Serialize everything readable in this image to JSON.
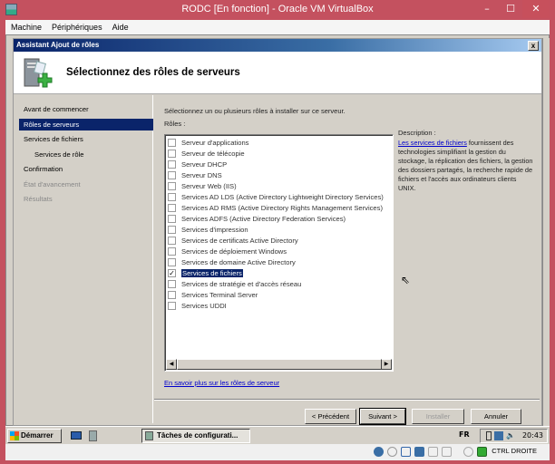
{
  "window": {
    "title": "RODC [En fonction] - Oracle VM VirtualBox",
    "minimize": "–",
    "maximize": "☐",
    "close": "✕"
  },
  "menu": [
    "Machine",
    "Périphériques",
    "Aide"
  ],
  "dialog": {
    "title": "Assistant Ajout de rôles",
    "close": "x",
    "header": "Sélectionnez des rôles de serveurs"
  },
  "nav": [
    {
      "label": "Avant de commencer",
      "state": "normal"
    },
    {
      "label": "Rôles de serveurs",
      "state": "selected"
    },
    {
      "label": "Services de fichiers",
      "state": "normal"
    },
    {
      "label": "Services de rôle",
      "state": "sub"
    },
    {
      "label": "Confirmation",
      "state": "normal"
    },
    {
      "label": "État d'avancement",
      "state": "disabled"
    },
    {
      "label": "Résultats",
      "state": "disabled"
    }
  ],
  "main": {
    "instruction": "Sélectionnez un ou plusieurs rôles à installer sur ce serveur.",
    "roles_label": "Rôles :",
    "description_label": "Description :",
    "description_link": "Les services de fichiers",
    "description_text": " fournissent des technologies simplifiant la gestion du stockage, la réplication des fichiers, la gestion des dossiers partagés, la recherche rapide de fichiers et l'accès aux ordinateurs clients UNIX.",
    "learn_more": "En savoir plus sur les rôles de serveur",
    "roles": [
      {
        "label": "Serveur d'applications",
        "checked": false
      },
      {
        "label": "Serveur de télécopie",
        "checked": false
      },
      {
        "label": "Serveur DHCP",
        "checked": false
      },
      {
        "label": "Serveur DNS",
        "checked": false
      },
      {
        "label": "Serveur Web (IIS)",
        "checked": false
      },
      {
        "label": "Services AD LDS (Active Directory Lightweight Directory Services)",
        "checked": false
      },
      {
        "label": "Services AD RMS (Active Directory Rights Management Services)",
        "checked": false
      },
      {
        "label": "Services ADFS (Active Directory Federation Services)",
        "checked": false
      },
      {
        "label": "Services d'impression",
        "checked": false
      },
      {
        "label": "Services de certificats Active Directory",
        "checked": false
      },
      {
        "label": "Services de déploiement Windows",
        "checked": false
      },
      {
        "label": "Services de domaine Active Directory",
        "checked": false
      },
      {
        "label": "Services de fichiers",
        "checked": true
      },
      {
        "label": "Services de stratégie et d'accès réseau",
        "checked": false
      },
      {
        "label": "Services Terminal Server",
        "checked": false
      },
      {
        "label": "Services UDDI",
        "checked": false
      }
    ]
  },
  "buttons": {
    "previous": "< Précédent",
    "next": "Suivant >",
    "install": "Installer",
    "cancel": "Annuler"
  },
  "taskbar": {
    "start": "Démarrer",
    "app": "Tâches de configurati...",
    "lang": "FR",
    "clock": "20:43"
  },
  "vbox_status": {
    "host_key": "CTRL DROITE"
  }
}
